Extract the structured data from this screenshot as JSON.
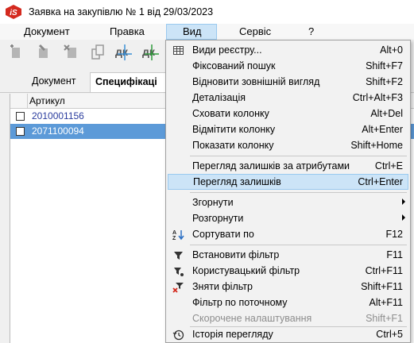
{
  "window": {
    "title": "Заявка на закупівлю № 1 від 29/03/2023",
    "logo_text": "iS"
  },
  "menubar": {
    "items": [
      {
        "label": "Документ"
      },
      {
        "label": "Правка"
      },
      {
        "label": "Вид"
      },
      {
        "label": "Сервіс"
      },
      {
        "label": "?"
      }
    ],
    "active": "Вид"
  },
  "toolbar": {
    "icons": [
      "add-doc-icon",
      "edit-doc-icon",
      "delete-doc-icon",
      "copy-doc-icon",
      "debit-credit-icon",
      "debit-credit-green-icon"
    ],
    "dk_text": "дк"
  },
  "tabs": [
    {
      "label": "Документ"
    },
    {
      "label": "Специфікаці"
    }
  ],
  "grid": {
    "column": "Артикул",
    "rows": [
      {
        "value": "2010001156",
        "selected": false
      },
      {
        "value": "2071100094",
        "selected": true
      }
    ]
  },
  "view_menu": {
    "items": [
      {
        "label": "Види реєстру...",
        "shortcut": "Alt+0",
        "icon": "table-icon"
      },
      {
        "label": "Фіксований пошук",
        "shortcut": "Shift+F7"
      },
      {
        "label": "Відновити зовнішній вигляд",
        "shortcut": "Shift+F2"
      },
      {
        "label": "Деталізація",
        "shortcut": "Ctrl+Alt+F3"
      },
      {
        "label": "Сховати колонку",
        "shortcut": "Alt+Del"
      },
      {
        "label": "Відмітити колонку",
        "shortcut": "Alt+Enter"
      },
      {
        "label": "Показати колонку",
        "shortcut": "Shift+Home"
      },
      {
        "label": "Перегляд залишків за атрибутами",
        "shortcut": "Ctrl+E"
      },
      {
        "label": "Перегляд залишків",
        "shortcut": "Ctrl+Enter",
        "highlighted": true
      },
      {
        "label": "Згорнути",
        "submenu": true
      },
      {
        "label": "Розгорнути",
        "submenu": true
      },
      {
        "label": "Сортувати по",
        "shortcut": "F12",
        "icon": "sort-az-icon"
      },
      {
        "label": "Встановити фільтр",
        "shortcut": "F11",
        "icon": "filter-icon"
      },
      {
        "label": "Користувацький фільтр",
        "shortcut": "Ctrl+F11",
        "icon": "custom-filter-icon"
      },
      {
        "label": "Зняти фільтр",
        "shortcut": "Shift+F11",
        "icon": "remove-filter-icon"
      },
      {
        "label": "Фільтр по поточному",
        "shortcut": "Alt+F11"
      },
      {
        "label": "Скорочене налаштування",
        "shortcut": "Shift+F1",
        "disabled": true
      },
      {
        "label": "Історія перегляду",
        "shortcut": "Ctrl+5",
        "icon": "history-icon"
      }
    ]
  },
  "colors": {
    "accent_highlight": "#cce4f7",
    "selection_row": "#5c9ad8",
    "link_text": "#2a3c9e",
    "logo_red": "#d42a1f"
  }
}
